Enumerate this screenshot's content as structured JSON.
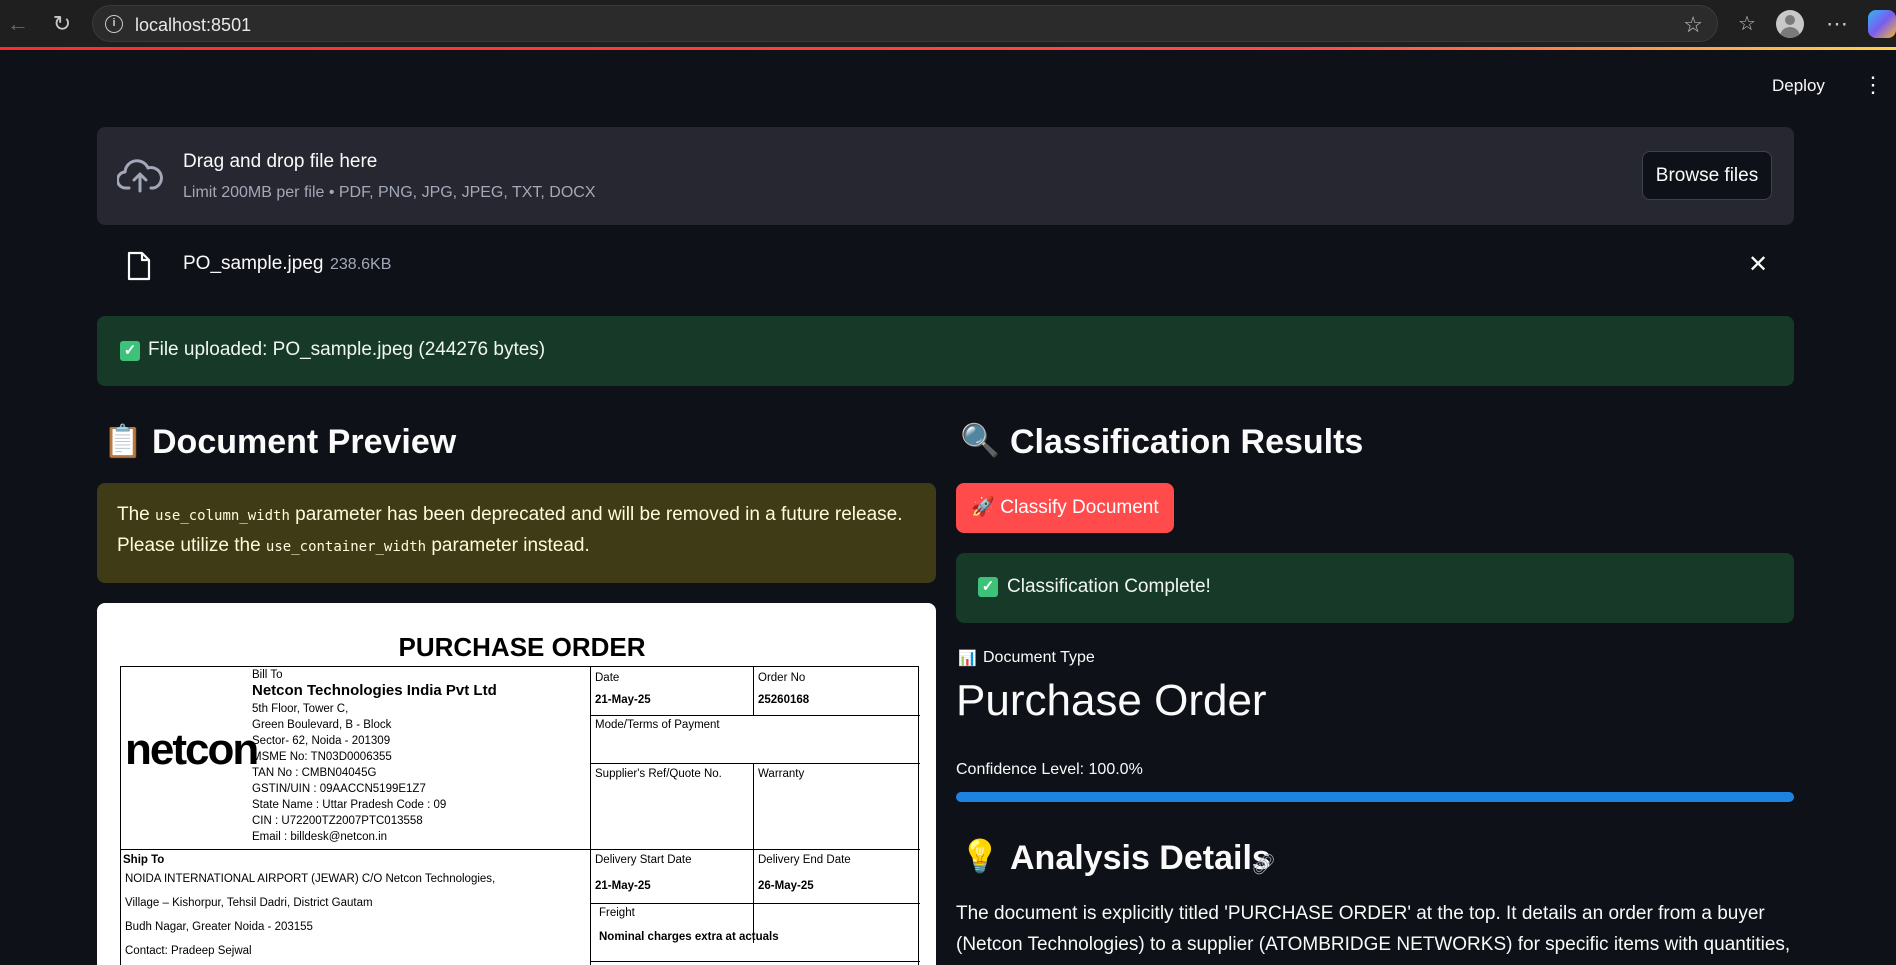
{
  "browser": {
    "url": "localhost:8501"
  },
  "header": {
    "deploy_label": "Deploy",
    "menu_icon": "⋮"
  },
  "uploader": {
    "title": "Drag and drop file here",
    "subtitle": "Limit 200MB per file • PDF, PNG, JPG, JPEG, TXT, DOCX",
    "browse_label": "Browse files",
    "file_name": "PO_sample.jpeg",
    "file_size": "238.6KB"
  },
  "upload_alert": {
    "icon": "✓",
    "text": "File uploaded: PO_sample.jpeg (244276 bytes)"
  },
  "preview": {
    "emoji": "📋",
    "heading": "Document Preview",
    "warning_pre": "The ",
    "warning_code1": "use_column_width",
    "warning_mid": " parameter has been deprecated and will be removed in a future release.",
    "warning_pre2": "Please utilize the ",
    "warning_code2": "use_container_width",
    "warning_post": " parameter instead."
  },
  "po": {
    "title": "PURCHASE ORDER",
    "logo": "netcon",
    "bill_to_label": "Bill To",
    "company": "Netcon Technologies India Pvt Ltd",
    "address_lines": [
      "5th Floor, Tower C,",
      "Green Boulevard, B - Block",
      "Sector- 62, Noida - 201309",
      "MSME No: TN03D0006355",
      "TAN No :   CMBN04045G",
      "GSTIN/UIN :  09AACCN5199E1Z7",
      "State Name :     Uttar Pradesh    Code :    09",
      "CIN : U72200TZ2007PTC013558",
      "Email : billdesk@netcon.in"
    ],
    "date_label": "Date",
    "date_value": "21-May-25",
    "order_no_label": "Order No",
    "order_no_value": "25260168",
    "mode_label": "Mode/Terms of Payment",
    "supplier_ref_label": "Supplier's Ref/Quote No.",
    "warranty_label": "Warranty",
    "ship_to_label": "Ship To",
    "ship_lines": [
      "NOIDA INTERNATIONAL AIRPORT (JEWAR) C/O Netcon Technologies,",
      "Village – Kishorpur, Tehsil Dadri, District Gautam",
      "Budh Nagar, Greater Noida - 203155",
      "Contact: Pradeep Sejwal"
    ],
    "delivery_start_label": "Delivery Start Date",
    "delivery_start_value": "21-May-25",
    "delivery_end_label": "Delivery End Date",
    "delivery_end_value": "26-May-25",
    "freight_label": "Freight",
    "freight_value": "Nominal charges extra at actuals"
  },
  "classification": {
    "emoji": "🔍",
    "heading": "Classification Results",
    "button_label": "🚀 Classify Document",
    "complete_icon": "✓",
    "complete_text": "Classification Complete!",
    "doc_type_emoji": "📊",
    "doc_type_label": "Document Type",
    "doc_type_value": "Purchase Order",
    "confidence_label": "Confidence Level: 100.0%",
    "confidence_fraction": 1.0,
    "analysis_emoji": "💡",
    "analysis_heading": "Analysis Details",
    "analysis_lines": [
      "The document is explicitly titled 'PURCHASE ORDER' at the top. It details an order from a buyer",
      "(Netcon Technologies) to a supplier (ATOMBRIDGE NETWORKS) for specific items with quantities,"
    ]
  },
  "colors": {
    "accent": "#ff4b4b",
    "progress": "#1c83e1",
    "success_bg": "#173928",
    "warning_bg": "#3e3b16"
  }
}
